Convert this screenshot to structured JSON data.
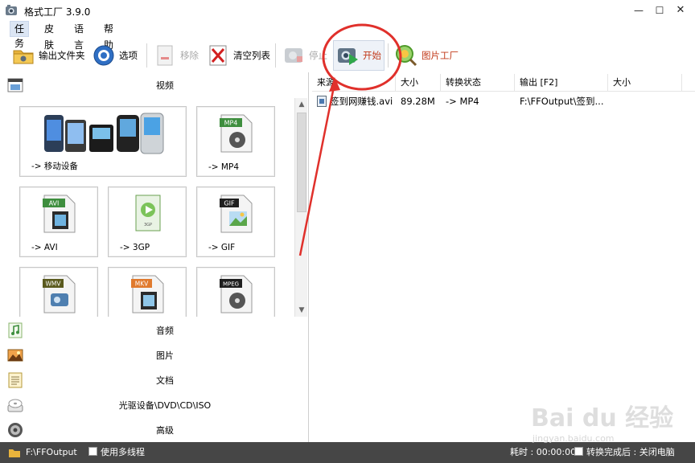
{
  "window": {
    "title": "格式工厂 3.9.0",
    "min": "—",
    "max": "☐",
    "close": "✕"
  },
  "menu": [
    "任务",
    "皮肤",
    "语言",
    "帮助"
  ],
  "toolbar": {
    "output_folder": "输出文件夹",
    "options": "选项",
    "remove": "移除",
    "clear_list": "清空列表",
    "stop": "停止",
    "start": "开始",
    "picture_factory": "图片工厂"
  },
  "categories": {
    "video": "视频",
    "audio": "音频",
    "picture": "图片",
    "document": "文档",
    "optical": "光驱设备\\DVD\\CD\\ISO",
    "advanced": "高级"
  },
  "video_tiles": [
    {
      "label": "-> 移动设备",
      "icon": "mobile-devices-icon"
    },
    {
      "label": "-> MP4",
      "icon": "mp4-file-icon",
      "badge": "MP4"
    },
    {
      "label": "-> AVI",
      "icon": "avi-file-icon",
      "badge": "AVI"
    },
    {
      "label": "-> 3GP",
      "icon": "3gp-file-icon",
      "badge": "3GP"
    },
    {
      "label": "-> GIF",
      "icon": "gif-file-icon",
      "badge": "GIF"
    },
    {
      "label": "",
      "icon": "wmv-file-icon",
      "badge": "WMV"
    },
    {
      "label": "",
      "icon": "mkv-file-icon",
      "badge": "MKV"
    },
    {
      "label": "",
      "icon": "mpeg-file-icon",
      "badge": "MPEG"
    }
  ],
  "table": {
    "headers": [
      "来源",
      "大小",
      "转换状态",
      "输出 [F2]",
      "大小"
    ],
    "rows": [
      {
        "source": "签到网赚钱.avi",
        "size": "89.28M",
        "status": "-> MP4",
        "output": "F:\\FFOutput\\签到...",
        "out_size": ""
      }
    ]
  },
  "statusbar": {
    "output_path": "F:\\FFOutput",
    "multithread": "使用多线程",
    "elapsed": "耗时 : 00:00:00",
    "after_convert": "转换完成后 : 关闭电脑"
  },
  "watermark": {
    "main": "Bai du 经验",
    "sub": "jingyan.baidu.com"
  },
  "colors": {
    "statusbar_bg": "#464646",
    "annotation_red": "#e0302b",
    "start_text": "#c23a1a",
    "picture_factory_text": "#c23a1a"
  }
}
